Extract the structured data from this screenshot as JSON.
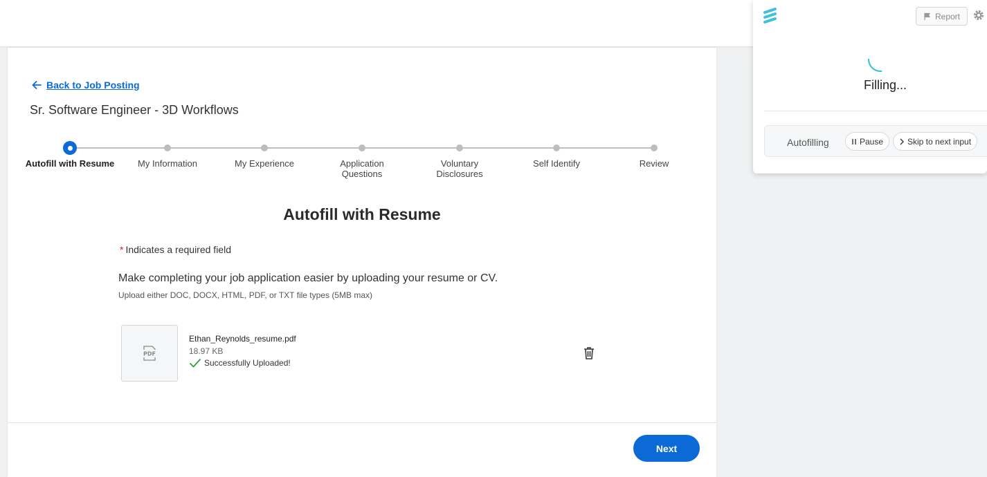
{
  "page": {
    "back_link": "Back to Job Posting",
    "job_title": "Sr. Software Engineer - 3D Workflows"
  },
  "steps": [
    {
      "label": "Autofill with Resume",
      "current": true
    },
    {
      "label": "My Information"
    },
    {
      "label": "My Experience"
    },
    {
      "label": "Application Questions"
    },
    {
      "label": "Voluntary Disclosures"
    },
    {
      "label": "Self Identify"
    },
    {
      "label": "Review"
    }
  ],
  "section": {
    "title": "Autofill with Resume",
    "required_marker": "*",
    "required_note": "Indicates a required field",
    "upload_intro": "Make completing your job application easier by uploading your resume or CV.",
    "upload_hint": "Upload either DOC, DOCX, HTML, PDF, or TXT file types (5MB max)"
  },
  "file": {
    "thumb_label": "PDF",
    "name": "Ethan_Reynolds_resume.pdf",
    "size": "18.97 KB",
    "status": "Successfully Uploaded!"
  },
  "footer": {
    "next_label": "Next"
  },
  "extension": {
    "report_label": "Report",
    "state_label": "Filling...",
    "status_label": "Autofilling",
    "pause_label": "Pause",
    "skip_label": "Skip to next input",
    "icons": [
      "logo-icon",
      "flag-icon",
      "gear-icon",
      "spinner-icon",
      "pause-icon",
      "chevron-right-icon"
    ]
  },
  "colors": {
    "primary": "#0b6ad6",
    "required": "#d12020",
    "success": "#2e9e3e",
    "extension_accent": "#3cc3d8"
  }
}
